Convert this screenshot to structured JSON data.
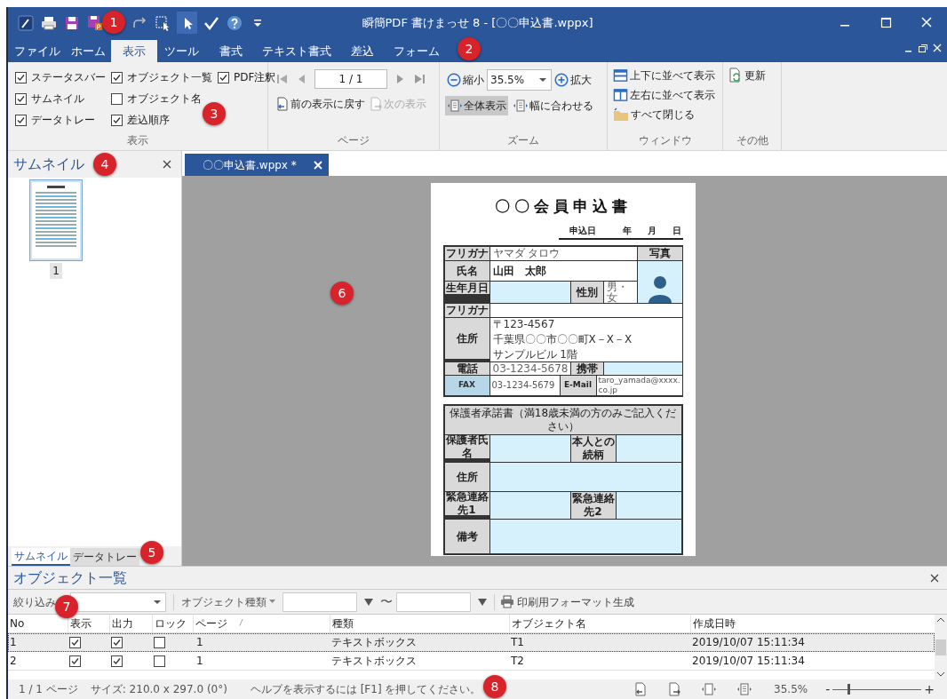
{
  "window": {
    "title": "瞬簡PDF 書けまっせ 8 - [〇〇申込書.wppx]"
  },
  "quick_access": [
    {
      "kind": "app",
      "selected": false
    },
    {
      "kind": "print",
      "selected": false
    },
    {
      "kind": "save",
      "selected": false
    },
    {
      "kind": "save_pdf",
      "selected": false
    },
    {
      "kind": "redo",
      "selected": false
    },
    {
      "kind": "select_object",
      "selected": false
    },
    {
      "kind": "pointer",
      "selected": true
    },
    {
      "kind": "check",
      "selected": false
    },
    {
      "kind": "help",
      "selected": false
    },
    {
      "kind": "menu",
      "selected": false
    }
  ],
  "ribbon_tabs": [
    {
      "label": "ファイル",
      "selected": false
    },
    {
      "label": "ホーム",
      "selected": false
    },
    {
      "label": "表示",
      "selected": true
    },
    {
      "label": "ツール",
      "selected": false
    },
    {
      "label": "書式",
      "selected": false
    },
    {
      "label": "テキスト書式",
      "selected": false
    },
    {
      "label": "差込",
      "selected": false
    },
    {
      "label": "フォーム",
      "selected": false
    }
  ],
  "ribbon": {
    "display_group": {
      "label": "表示",
      "options": [
        {
          "label": "ステータスバー",
          "checked": true
        },
        {
          "label": "サムネイル",
          "checked": true
        },
        {
          "label": "データトレー",
          "checked": true
        },
        {
          "label": "オブジェクト一覧",
          "checked": true
        },
        {
          "label": "オブジェクト名",
          "checked": false
        },
        {
          "label": "差込順序",
          "checked": true
        },
        {
          "label": "PDF注釈",
          "checked": true
        }
      ]
    },
    "page_group": {
      "label": "ページ",
      "page_field": "1 / 1",
      "history": [
        {
          "label": "前の表示に戻す",
          "disabled": false
        },
        {
          "label": "次の表示",
          "disabled": true
        }
      ]
    },
    "zoom_group": {
      "label": "ズーム",
      "zoom_out": "縮小",
      "zoom_value": "35.5%",
      "zoom_in": "拡大",
      "fit": [
        {
          "label": "全体表示",
          "selected": true
        },
        {
          "label": "幅に合わせる",
          "selected": false
        }
      ]
    },
    "window_group": {
      "label": "ウィンドウ",
      "items": [
        {
          "kind": "horizontal",
          "label": "上下に並べて表示"
        },
        {
          "kind": "vertical",
          "label": "左右に並べて表示"
        },
        {
          "kind": "close_all",
          "label": "すべて閉じる"
        }
      ]
    },
    "other_group": {
      "label": "その他",
      "refresh": "更新"
    }
  },
  "thumbnail_panel": {
    "title": "サムネイル",
    "pages": [
      {
        "label": "1",
        "selected": true
      }
    ],
    "tabs": [
      {
        "label": "サムネイル",
        "selected": true
      },
      {
        "label": "データトレー",
        "selected": false
      }
    ]
  },
  "document_tabs": [
    {
      "label": "〇〇申込書.wppx *",
      "selected": true
    }
  ],
  "document": {
    "title": "〇〇会員申込書",
    "date_label": "申込日",
    "date_parts": [
      "年",
      "月",
      "日"
    ],
    "applicant": {
      "furigana_label": "フリガナ",
      "furigana": "ヤマダ タロウ",
      "name_label": "氏名",
      "name": "山田　太郎",
      "photo_label": "写真",
      "birth_label": "生年月日",
      "gender_label": "性別",
      "gender": "男・女",
      "address_furigana_label": "フリガナ",
      "address_label": "住所",
      "address_lines": [
        "〒123-4567",
        "千葉県〇〇市〇〇町X－X－X",
        "サンプルビル 1階"
      ],
      "phone_label": "電話",
      "phone": "03-1234-5678",
      "mobile_label": "携帯",
      "fax_label": "FAX",
      "fax": "03-1234-5679",
      "email_label": "E-Mail",
      "email": "taro_yamada@xxxx.co.jp"
    },
    "guardian": {
      "heading": "保護者承諾書（満18歳未満の方のみご記入ください）",
      "name_label": "保護者氏名",
      "relation_label": "本人との続柄",
      "address_label": "住所",
      "contact1_label": "緊急連絡先1",
      "contact2_label": "緊急連絡先2",
      "notes_label": "備考"
    }
  },
  "object_list": {
    "title": "オブジェクト一覧",
    "filter_label": "絞り込み",
    "type_filter": "オブジェクト種類",
    "range_separator": "〜",
    "generate_button": "印刷用フォーマット生成",
    "columns": [
      "No",
      "表示",
      "出力",
      "ロック",
      "ページ",
      "種類",
      "オブジェクト名",
      "作成日時"
    ],
    "sort_mark": "/",
    "rows": [
      {
        "no": "1",
        "visible": true,
        "output": true,
        "locked": false,
        "page": "1",
        "type": "テキストボックス",
        "name": "T1",
        "created": "2019/10/07 15:11:34",
        "selected": true
      },
      {
        "no": "2",
        "visible": true,
        "output": true,
        "locked": false,
        "page": "1",
        "type": "テキストボックス",
        "name": "T2",
        "created": "2019/10/07 15:11:34",
        "selected": false
      }
    ]
  },
  "status_bar": {
    "page": "1 / 1 ページ",
    "size": "サイズ: 210.0 x 297.0 (0°)",
    "help": "ヘルプを表示するには [F1] を押してください。",
    "zoom": "35.5%",
    "minus": "-",
    "plus": "+",
    "zoom_slider": {
      "level": 0.17
    }
  },
  "annotations": [
    {
      "label": "1"
    },
    {
      "label": "2"
    },
    {
      "label": "3"
    },
    {
      "label": "4"
    },
    {
      "label": "5"
    },
    {
      "label": "6"
    },
    {
      "label": "7"
    },
    {
      "label": "8"
    }
  ]
}
